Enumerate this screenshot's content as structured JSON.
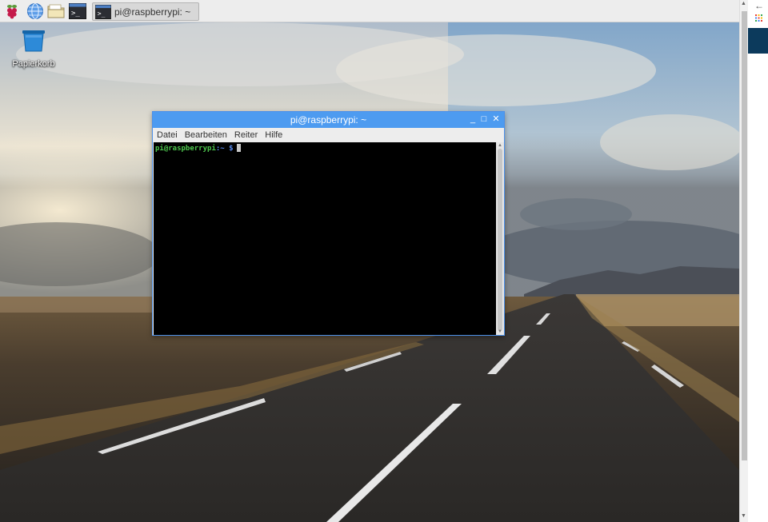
{
  "panel": {
    "task_button_label": "pi@raspberrypi: ~",
    "launcher_icons": [
      "raspberry-menu-icon",
      "web-browser-icon",
      "file-manager-icon",
      "terminal-icon"
    ]
  },
  "desktop": {
    "trash_label": "Papierkorb"
  },
  "terminal": {
    "title": "pi@raspberrypi: ~",
    "menu": [
      "Datei",
      "Bearbeiten",
      "Reiter",
      "Hilfe"
    ],
    "prompt_user": "pi@raspberrypi",
    "prompt_path": ":~",
    "prompt_symbol": " $",
    "buttons": {
      "minimize": "_",
      "maximize": "□",
      "close": "✕"
    }
  },
  "browser": {
    "back_glyph": "←"
  },
  "colors": {
    "titlebar": "#4d9bf0",
    "prompt_user": "#4ec84e",
    "prompt_path": "#5a8cf0",
    "terminal_bg": "#000000",
    "panel_bg": "#ededed"
  }
}
